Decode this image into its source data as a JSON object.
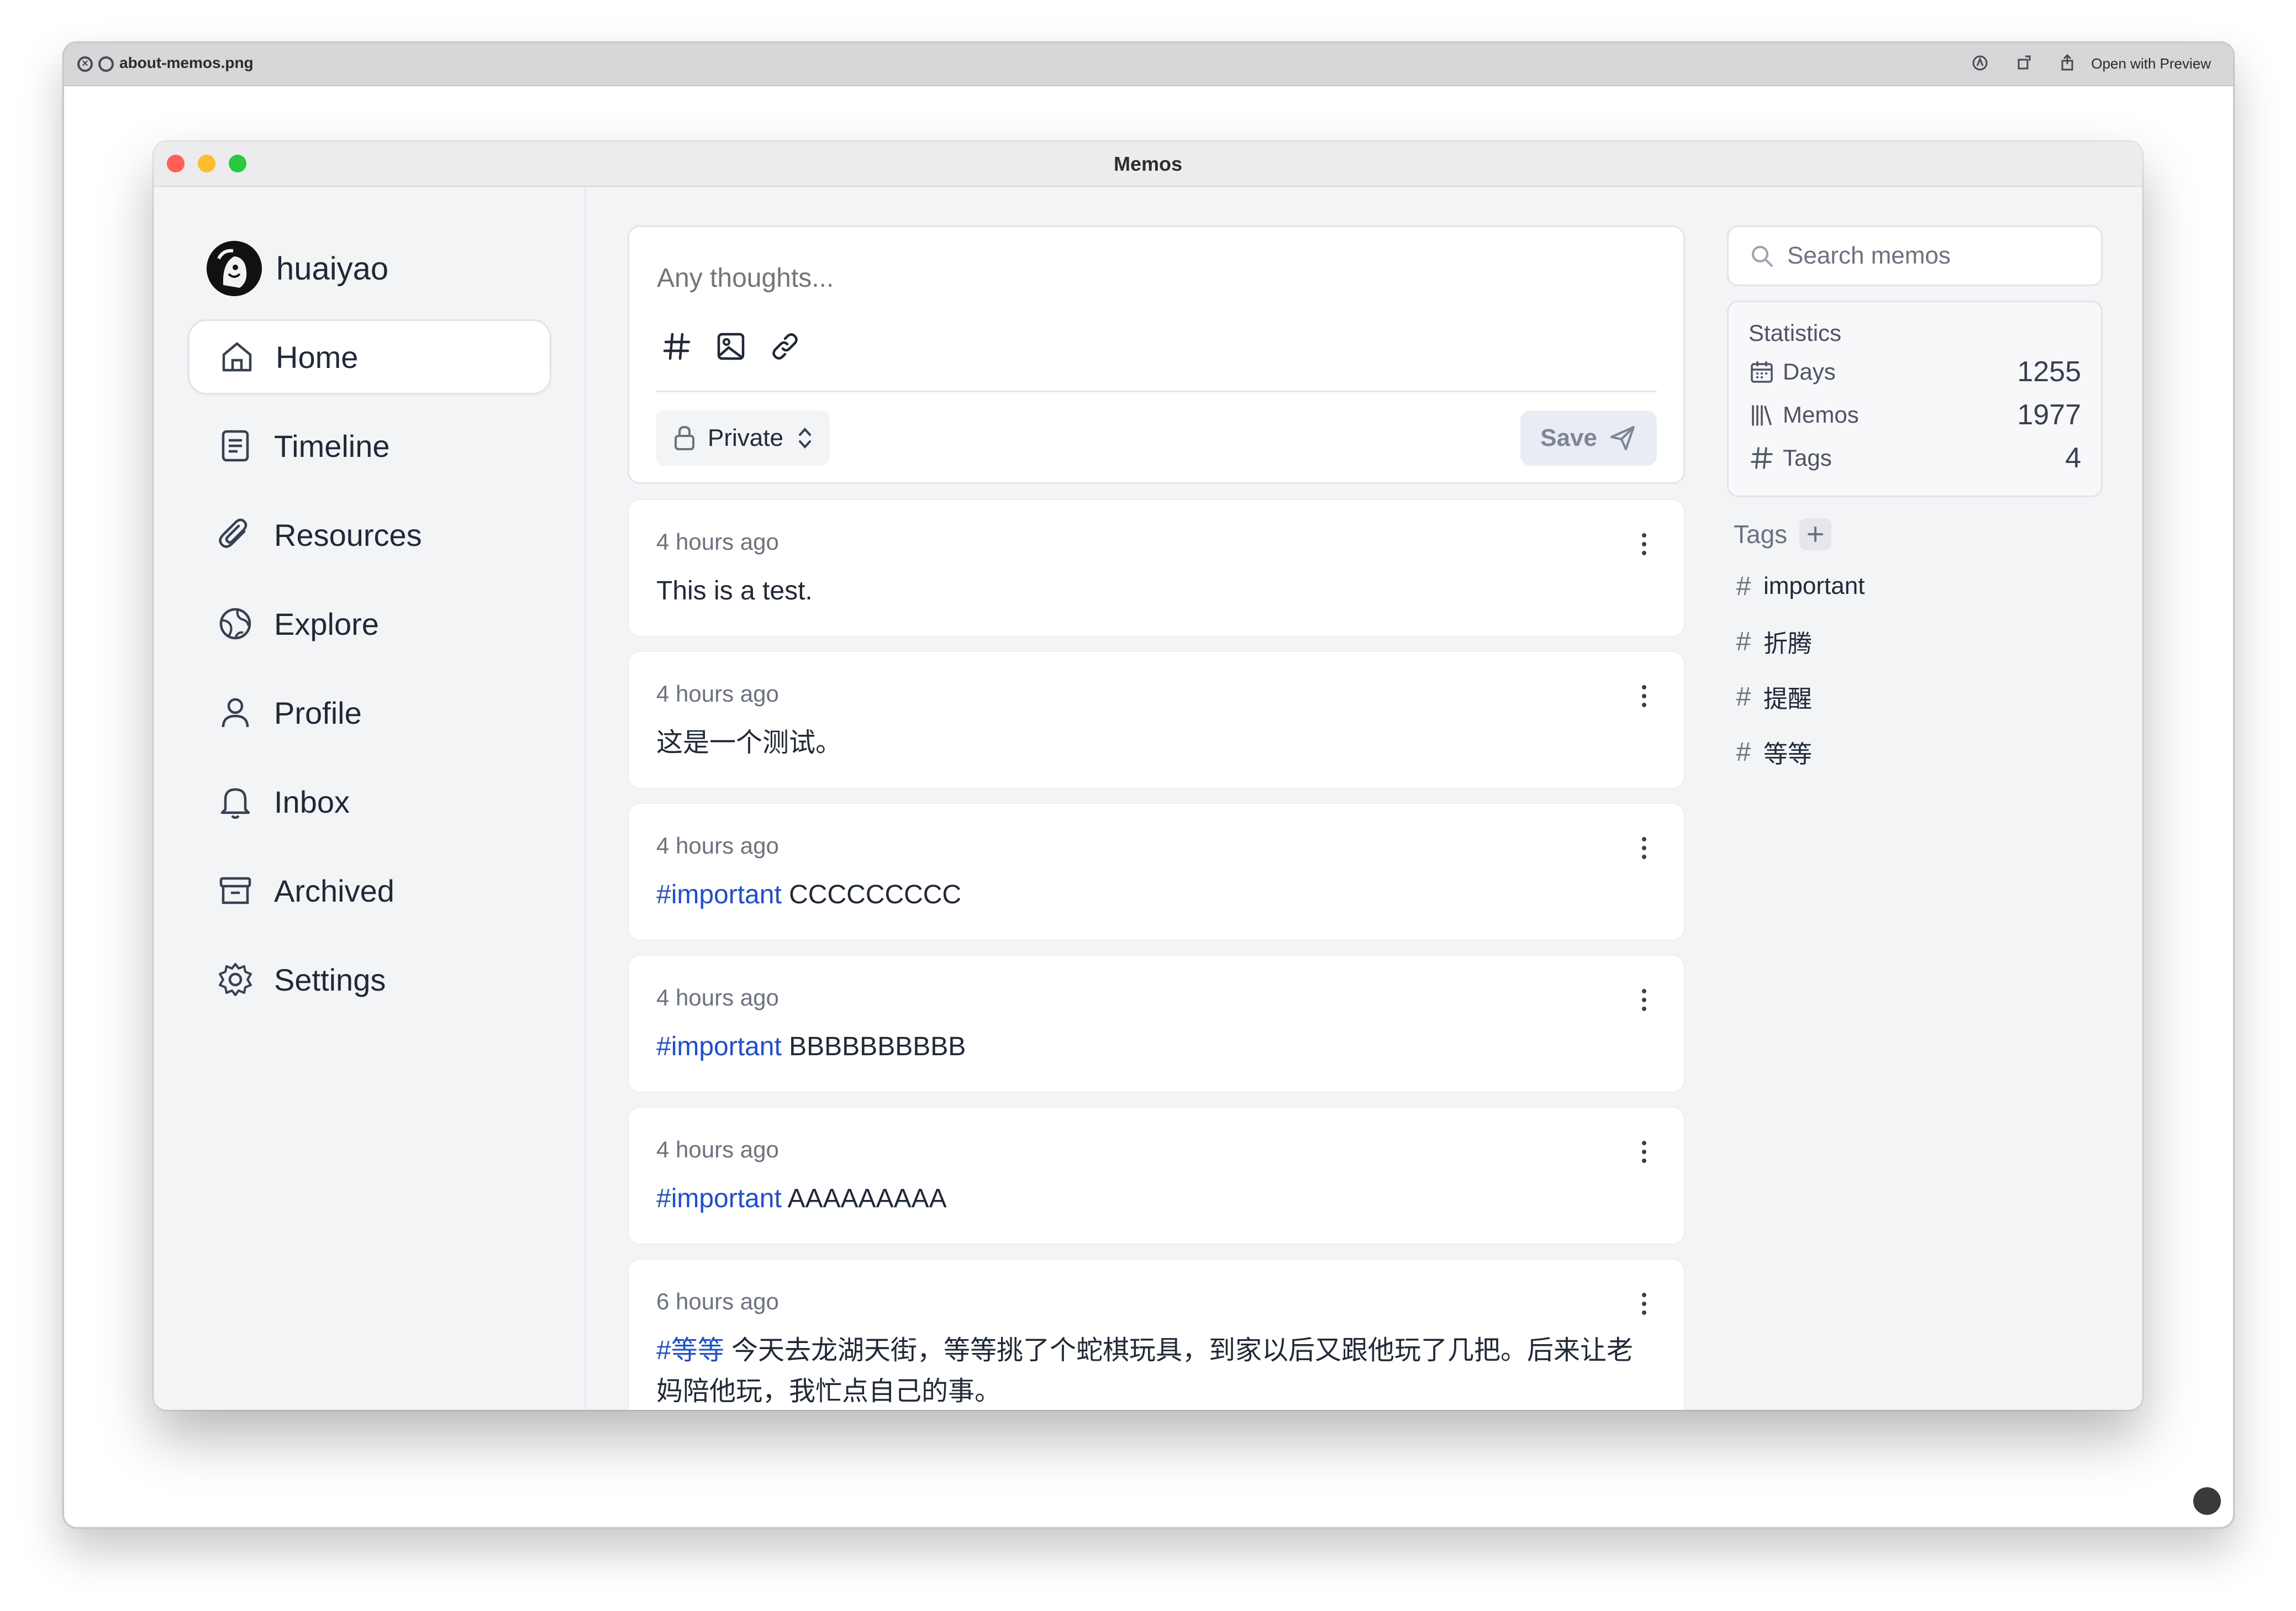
{
  "outer": {
    "title": "about-memos.png",
    "open_with": "Open with Preview"
  },
  "app": {
    "window_title": "Memos",
    "user": {
      "name": "huaiyao"
    },
    "nav": [
      {
        "label": "Home",
        "icon": "home-icon",
        "active": true
      },
      {
        "label": "Timeline",
        "icon": "timeline-icon"
      },
      {
        "label": "Resources",
        "icon": "paperclip-icon"
      },
      {
        "label": "Explore",
        "icon": "globe-icon"
      },
      {
        "label": "Profile",
        "icon": "user-icon"
      },
      {
        "label": "Inbox",
        "icon": "bell-icon"
      },
      {
        "label": "Archived",
        "icon": "archive-icon"
      },
      {
        "label": "Settings",
        "icon": "gear-icon"
      }
    ],
    "editor": {
      "placeholder": "Any thoughts...",
      "visibility": "Private",
      "save_label": "Save"
    },
    "memos": [
      {
        "time": "4 hours ago",
        "tag": "",
        "text": "This is a test."
      },
      {
        "time": "4 hours ago",
        "tag": "",
        "text": "这是一个测试。"
      },
      {
        "time": "4 hours ago",
        "tag": "#important",
        "text": " CCCCCCCCC"
      },
      {
        "time": "4 hours ago",
        "tag": "#important",
        "text": " BBBBBBBBBB"
      },
      {
        "time": "4 hours ago",
        "tag": "#important",
        "text": " AAAAAAAAA"
      },
      {
        "time": "6 hours ago",
        "tag": "#等等",
        "text": " 今天去龙湖天街，等等挑了个蛇棋玩具，到家以后又跟他玩了几把。后来让老妈陪他玩，我忙点自己的事。"
      }
    ],
    "search": {
      "placeholder": "Search memos"
    },
    "statistics": {
      "title": "Statistics",
      "days_label": "Days",
      "days_value": "1255",
      "memos_label": "Memos",
      "memos_value": "1977",
      "tags_label": "Tags",
      "tags_value": "4"
    },
    "tags": {
      "title": "Tags",
      "items": [
        "important",
        "折腾",
        "提醒",
        "等等"
      ]
    },
    "colors": {
      "tag_link": "#1d4ed8",
      "background": "#f3f4f6"
    }
  }
}
